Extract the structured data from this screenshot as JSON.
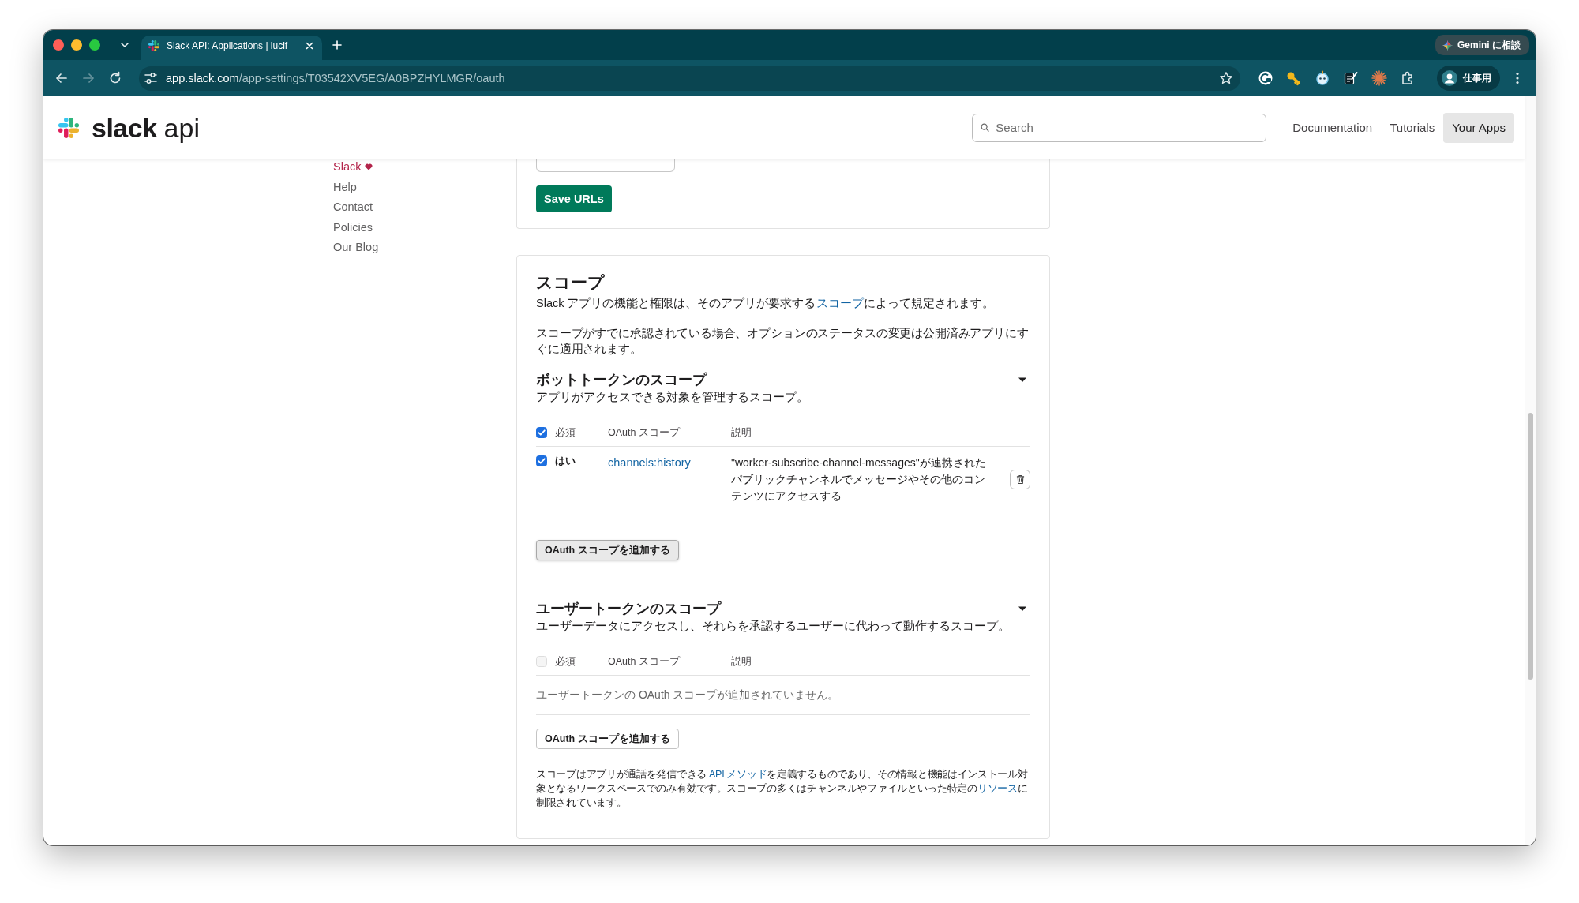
{
  "browser": {
    "tabs": [
      {
        "title": "Slack API: Applications | lucif",
        "selected": true
      }
    ],
    "gemini": "Gemini に相談",
    "nav": [
      {
        "kind": "back",
        "disabled": false
      },
      {
        "kind": "forward",
        "disabled": true
      },
      {
        "kind": "reload",
        "disabled": false
      }
    ],
    "address": {
      "host": "app.slack.com",
      "path": "/app-settings/T03542XV5EG/A0BPZHYLMGR/oauth"
    },
    "profile": "仕事用"
  },
  "header": {
    "logo": {
      "wordmark": "slack",
      "suffix": "api"
    },
    "search": {
      "placeholder": "Search"
    },
    "nav": [
      {
        "label": "Documentation",
        "selected": false
      },
      {
        "label": "Tutorials",
        "selected": false
      },
      {
        "label": "Your Apps",
        "selected": true
      }
    ]
  },
  "sidebar": {
    "links": [
      {
        "label": "Slack",
        "kind": "brand"
      },
      {
        "label": "Help",
        "kind": "plain"
      },
      {
        "label": "Contact",
        "kind": "plain"
      },
      {
        "label": "Policies",
        "kind": "plain"
      },
      {
        "label": "Our Blog",
        "kind": "plain"
      }
    ]
  },
  "redirect_card": {
    "save_button": "Save URLs"
  },
  "scopes": {
    "title": "スコープ",
    "intro": [
      {
        "text": "Slack アプリの機能と権限は、そのアプリが要求する",
        "kind": "text"
      },
      {
        "text": "スコープ",
        "kind": "link"
      },
      {
        "text": "によって規定されます。",
        "kind": "text"
      }
    ],
    "note": "スコープがすでに承認されている場合、オプションのステータスの変更は公開済みアプリにすぐに適用されます。",
    "sections": [
      {
        "title": "ボットトークンのスコープ",
        "subtitle": "アプリがアクセスできる対象を管理するスコープ。",
        "expanded": true,
        "columns": [
          "必須",
          "OAuth スコープ",
          "説明"
        ],
        "header_checkbox": {
          "checked": true,
          "disabled": false
        },
        "rows": [
          {
            "checked": true,
            "required": "はい",
            "scope": "channels:history",
            "description": "\"worker-subscribe-channel-messages\"が連携されたパブリックチャンネルでメッセージやその他のコンテンツにアクセスする"
          }
        ],
        "add_button": {
          "label": "OAuth スコープを追加する",
          "hovered": true
        }
      },
      {
        "title": "ユーザートークンのスコープ",
        "subtitle": "ユーザーデータにアクセスし、それらを承認するユーザーに代わって動作するスコープ。",
        "expanded": true,
        "columns": [
          "必須",
          "OAuth スコープ",
          "説明"
        ],
        "header_checkbox": {
          "checked": false,
          "disabled": true
        },
        "empty_message": "ユーザートークンの OAuth スコープが追加されていません。",
        "add_button": {
          "label": "OAuth スコープを追加する",
          "hovered": false
        }
      }
    ],
    "footnote": [
      {
        "text": "スコープはアプリが通話を発信できる ",
        "kind": "text"
      },
      {
        "text": "API メソッド",
        "kind": "link"
      },
      {
        "text": "を定義するものであり、その情報と機能はインストール対象となるワークスペースでのみ有効です。スコープの多くはチャンネルやファイルといった特定の",
        "kind": "text"
      },
      {
        "text": "リソース",
        "kind": "link"
      },
      {
        "text": "に制限されています。",
        "kind": "text"
      }
    ]
  }
}
